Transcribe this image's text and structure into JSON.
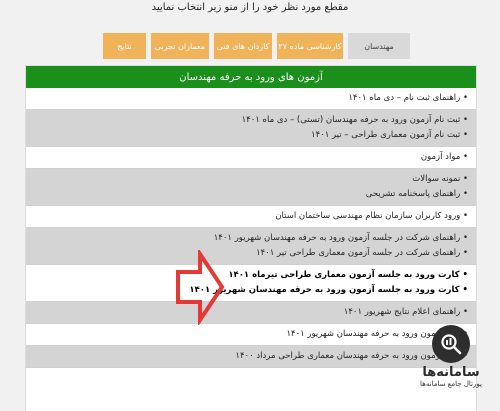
{
  "page": {
    "instruction": "مقطع مورد نظر خود را از منو زیر انتخاب نمایید"
  },
  "tabs": [
    {
      "label": "مهندسان",
      "active": true
    },
    {
      "label": "کارشناسی ماده ۲۷",
      "active": false
    },
    {
      "label": "کاردان های فنی",
      "active": false
    },
    {
      "label": "معماران تجربی",
      "active": false
    },
    {
      "label": "نتایج",
      "active": false
    }
  ],
  "panel": {
    "title": "آزمون های ورود به حرفه مهندسان",
    "rows": [
      {
        "style": "white",
        "lines": [
          "راهنمای ثبت نام – دی ماه ۱۴۰۱"
        ]
      },
      {
        "style": "gray",
        "lines": [
          "ثبت نام آزمون ورود به حرفه مهندسان (تستی) – دی ماه ۱۴۰۱",
          "ثبت نام آزمون معماری طراحی – تیر ۱۴۰۱"
        ]
      },
      {
        "style": "white",
        "lines": [
          "مواد آزمون"
        ]
      },
      {
        "style": "gray",
        "lines": [
          "نمونه سوالات",
          "راهنمای پاسخنامه تشریحی"
        ]
      },
      {
        "style": "white",
        "lines": [
          "ورود کاربران سازمان نظام مهندسی ساختمان استان"
        ]
      },
      {
        "style": "gray",
        "lines": [
          "راهنمای شرکت در جلسه آزمون ورود به حرفه مهندسان شهریور ۱۴۰۱",
          "راهنمای شرکت در جلسه آزمون معماری طراحی تیر ۱۴۰۱"
        ]
      },
      {
        "style": "white",
        "bold": true,
        "lines": [
          "کارت ورود به جلسه آزمون معماری طراحی تیرماه ۱۴۰۱",
          "کارت ورود به جلسه آزمون ورود به حرفه مهندسان شهریور ۱۴۰۱"
        ]
      },
      {
        "style": "gray",
        "lines": [
          "راهنمای اعلام نتایج شهریور ۱۴۰۱"
        ]
      },
      {
        "style": "white",
        "lines": [
          "نتایج آزمون ورود به حرفه مهندسان شهریور ۱۴۰۱"
        ]
      },
      {
        "style": "gray",
        "lines": [
          "نتایج آزمون ورود به حرفه مهندسان معماری طراحی مرداد ۱۴۰۰"
        ]
      }
    ]
  },
  "logo": {
    "name": "سامانه‌ها",
    "subtitle": "پورتال جامع سامانه‌ها",
    "icon": "magnifier-icon"
  },
  "colors": {
    "header_green": "#1b8f1b",
    "tab_orange": "#f0b35a",
    "tab_active": "#d9d9d9",
    "row_gray": "#d4d4d4",
    "arrow_red": "#e53935"
  }
}
